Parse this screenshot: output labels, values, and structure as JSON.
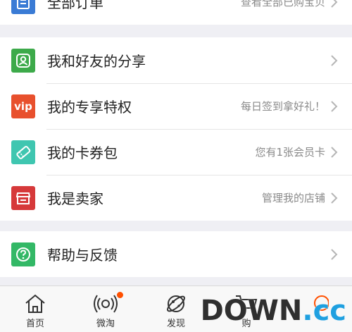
{
  "top_row": {
    "label": "全部订单",
    "hint": "查看全部已购宝贝"
  },
  "menu": [
    {
      "label": "我和好友的分享",
      "hint": "",
      "icon": "friends-share-icon",
      "color": "#3daa4a"
    },
    {
      "label": "我的专享特权",
      "hint": "每日签到拿好礼！",
      "icon": "vip-icon",
      "icon_text": "vip",
      "color": "#e8502d"
    },
    {
      "label": "我的卡券包",
      "hint": "您有1张会员卡",
      "icon": "card-coupon-icon",
      "color": "#3fc6b0"
    },
    {
      "label": "我是卖家",
      "hint": "管理我的店铺",
      "icon": "seller-store-icon",
      "color": "#d6393a"
    }
  ],
  "help": {
    "label": "帮助与反馈",
    "icon": "help-icon",
    "color": "#33b866"
  },
  "tabbar": [
    {
      "label": "首页",
      "icon": "home-icon"
    },
    {
      "label": "微淘",
      "icon": "broadcast-icon",
      "badge_dot": true
    },
    {
      "label": "发现",
      "icon": "discover-planet-icon"
    },
    {
      "label": "购",
      "icon": "cart-icon"
    },
    {
      "label": "",
      "icon": "profile-icon"
    }
  ],
  "watermark": {
    "main": "DOWN",
    "suffix": ".cc"
  }
}
